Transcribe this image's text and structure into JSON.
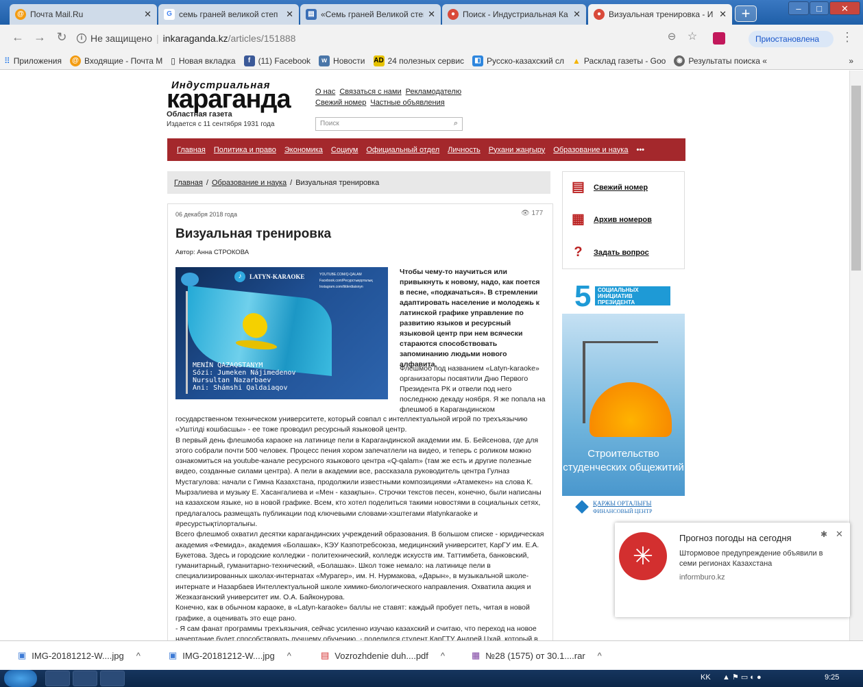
{
  "browser": {
    "tabs": [
      {
        "label": "Почта Mail.Ru",
        "icon": "mailru-icon"
      },
      {
        "label": "семь граней великой степ",
        "icon": "google-icon"
      },
      {
        "label": "«Семь граней Великой степ",
        "icon": "doc-icon"
      },
      {
        "label": "Поиск - Индустриальная Ка",
        "icon": "site-icon"
      },
      {
        "label": "Визуальная тренировка - И",
        "icon": "site-icon"
      }
    ],
    "security": "Не защищено",
    "url_host": "inkaraganda.kz",
    "url_path": "/articles/151888",
    "paused_label": "Приостановлена",
    "bookmarks": [
      "Приложения",
      "Входящие - Почта М",
      "Новая вкладка",
      "(11) Facebook",
      "Новости",
      "24 полезных сервис",
      "Русско-казахский сл",
      "Расклад газеты - Goo",
      "Результаты поиска «"
    ]
  },
  "site": {
    "logo_top": "Индустриальная",
    "logo_main": "караганда",
    "tagline": "Областная газета",
    "since": "Издается с 11 сентября 1931 года",
    "top_links": [
      "О нас",
      "Связаться с нами",
      "Рекламодателю",
      "Свежий номер",
      "Частные объявления"
    ],
    "search_placeholder": "Поиск",
    "nav": [
      "Главная",
      "Политика и право",
      "Экономика",
      "Социум",
      "Официальный отдел",
      "Личность",
      "Рухани жаңғыру",
      "Образование и наука",
      "•••"
    ],
    "crumbs": [
      "Главная",
      "Образование и наука",
      "Визуальная тренировка"
    ]
  },
  "article": {
    "date": "06 декабря 2018 года",
    "views": "177",
    "title": "Визуальная тренировка",
    "author": "Автор: Анна СТРОКОВА",
    "image": {
      "brand": "LATYN-KARAOKE",
      "links": [
        "YOUTUBE.COM/Q-QALAM",
        "Facebook.com/Ресурстықорталық",
        "Instagram.com/tilderdiaisnyn"
      ],
      "lines": [
        "MENÍN QAZAQSTANYM",
        "Sózi: Jumeken Nájimedenov",
        "Nursultan Nazarbaev",
        "Ani: Shámshi Qaldaiaqov"
      ]
    },
    "lead": "Чтобы чему-то научиться или привыкнуть к новому, надо, как поется в песне, «подкачаться». В стремлении адаптировать население и молодежь к латинской графике управление по развитию языков и ресурсный языковой центр при нем всячески стараются способствовать запоминанию людьми нового алфавита.",
    "wrap": "Флешмоб под названием «Latyn-karaoke» организаторы посвятили Дню Первого Президента РК и отвели под него последнюю декаду ноября. Я же попала на флешмоб в Карагандинском",
    "paragraphs": [
      "государственном техническом университете, который совпал с интеллектуальной игрой по трехъязычию «Уштілді кошбасшы» - ее тоже проводил ресурсный языковой центр.",
      "В первый день флешмоба караоке на латинице пели в Карагандинской академии им. Б. Бейсенова, где для этого собрали почти 500 человек. Процесс пения хором запечатлели на видео, и теперь с роликом можно ознакомиться на youtube-канале ресурсного языкового центра «Q-qalam» (там же есть и другие полезные видео, созданные силами центра). А пели в академии все, рассказала руководитель центра Гулназ Мустагулова: начали с Гимна Казахстана, продолжили известными композициями «Атамекен» на слова К. Мырзалиева и музыку Е. Хасангалиева и «Мен - казақпын». Строчки текстов песен, конечно, были написаны на казахском языке, но в новой графике. Всем, кто хотел поделиться такими новостями в социальных сетях, предлагалось размещать публикации под ключевыми словами-хэштегами #latynkaraoke и #ресурстықтілорталығы.",
      "Всего флешмоб охватил десятки карагандинских учреждений образования. В большом списке - юридическая академия «Фемида», академия «Болашак», КЭУ Казпотребсоюза, медицинский университет, КарГУ им. Е.А. Букетова. Здесь и городские колледжи - политехнический, колледж искусств им. Таттимбета, банковский, гуманитарный, гуманитарно-технический, «Болашак». Школ тоже немало: на латинице пели в специализированных школах-интернатах «Мурагер», им. Н. Нурмакова, «Дарын», в музыкальной школе-интернате и Назарбаев Интеллектуальной школе химико-биологического направления. Охватила акция и Жезказганский университет им. О.А. Байконурова.",
      "Конечно, как в обычном караоке, в «Latyn-karaoke» баллы не ставят: каждый пробует петь, читая в новой графике, а оценивать это еще рано.",
      "- Я сам фанат программы трехъязычия, сейчас усиленно изучаю казахский и считаю, что переход на новое начертание будет способствовать лучшему обучению, - поделился студент КарГТУ Андрей Цхай, который в интеллектуальной игре «Уштілді кошбасшы» в день флешмоба занял 1-е место. - Караоке на латинице, считаю,"
    ]
  },
  "sidebar": {
    "items": [
      "Свежий номер",
      "Архив номеров",
      "Задать вопрос"
    ],
    "banner": {
      "title": "СОЦИАЛЬНЫХ ИНИЦИАТИВ ПРЕЗИДЕНТА",
      "number": "5",
      "text": "Строительство студенческих общежитий",
      "sponsor1": "ҚАРЖЫ ОРТАЛЫҒЫ",
      "sponsor2": "ФИНАНСОВЫЙ ЦЕНТР"
    }
  },
  "notification": {
    "title": "Прогноз погоды на сегодня",
    "text": "Штормовое предупреждение объявили в семи регионах Казахстана",
    "source": "informburo.kz"
  },
  "downloads": [
    {
      "name": "IMG-20181212-W....jpg",
      "icon": "image-file-icon"
    },
    {
      "name": "IMG-20181212-W....jpg",
      "icon": "image-file-icon"
    },
    {
      "name": "Vozrozhdenie duh....pdf",
      "icon": "pdf-file-icon"
    },
    {
      "name": "№28 (1575) от 30.1....rar",
      "icon": "rar-file-icon"
    }
  ],
  "taskbar": {
    "lang": "KK",
    "time": "9:25"
  },
  "colors": {
    "nav_red": "#a4282c",
    "tab_blue": "#1f5fa8",
    "link_blue": "#1a56c9"
  }
}
